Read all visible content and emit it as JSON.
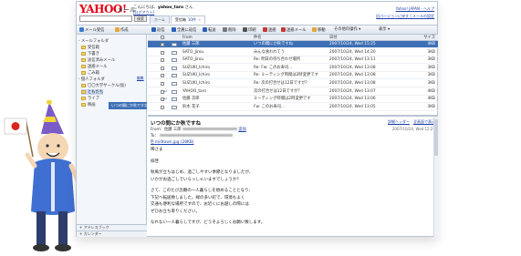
{
  "header": {
    "logo": "YAHOO!",
    "logo_sub": "JAPAN",
    "app_name": "メール",
    "greeting_prefix": "こんにちは、",
    "user": "yahoo_taro",
    "greeting_suffix": " さん",
    "logout": "[ログアウト]",
    "links": [
      "Yahoo! JAPAN - ヘルプ",
      "旧バージョンに戻す | メールの設定"
    ],
    "search_button": "検索"
  },
  "tabs": [
    {
      "label": "ホーム",
      "count": "",
      "active": false
    },
    {
      "label": "受信箱",
      "count": "10件",
      "active": true
    }
  ],
  "toolbar": [
    {
      "label": "メール受信",
      "icon": "mail-receive-icon",
      "color": "#3d7cc9"
    },
    {
      "label": "作成",
      "icon": "compose-icon",
      "color": "#e4a93a"
    },
    {
      "label": "返信",
      "icon": "reply-icon",
      "color": "#2a61b8"
    },
    {
      "label": "全員に返信",
      "icon": "reply-all-icon",
      "color": "#2a61b8"
    },
    {
      "label": "転送",
      "icon": "forward-icon",
      "color": "#2a61b8"
    },
    {
      "label": "削除",
      "icon": "delete-icon",
      "color": "#777777"
    },
    {
      "label": "印刷",
      "icon": "print-icon",
      "color": "#555555"
    },
    {
      "label": "迷惑",
      "icon": "spam-icon",
      "color": "#c23a3a"
    },
    {
      "label": "迷惑メール",
      "icon": "spam-mail-icon",
      "color": "#c23a3a"
    },
    {
      "label": "移動",
      "icon": "move-icon",
      "color": "#e4a93a"
    },
    {
      "label": "その他の操作 ▾",
      "icon": "",
      "color": ""
    },
    {
      "label": "表示 ▾",
      "icon": "",
      "color": ""
    }
  ],
  "sidebar": {
    "mail_folders_title": "- メールフォルダ",
    "mail_folders": [
      "受信箱",
      "下書き",
      "送信済みメール",
      "迷惑メール",
      "ごみ箱"
    ],
    "personal_title": "- 個人フォルダ",
    "edit_link": "編集",
    "personal_folders": [
      "〇〇大学サークル(仮)",
      "ともだち",
      "ライブ",
      "映画"
    ],
    "tooltip": "いつの間にか秋ですね",
    "bottom": [
      "+ アドレスブック",
      "+ カレンダー"
    ]
  },
  "message_list": {
    "columns": {
      "from": "From",
      "subject": "件名",
      "date": "日付",
      "size": "サイズ"
    },
    "rows": [
      {
        "from": "佐藤 三郎",
        "subject": "いつの間にか秋ですね",
        "date": "2007/10/24, Wed 15:25",
        "size": "4KB",
        "selected": true,
        "replied": false
      },
      {
        "from": "SATO_Jirou",
        "subject": "みんな食われてう",
        "date": "2007/10/24, Wed 14:20",
        "size": "3KB",
        "selected": false,
        "replied": false
      },
      {
        "from": "SATO_Jirou",
        "subject": "Re: 明日の待ち合わせ場所",
        "date": "2007/10/24, Wed 13:11",
        "size": "3KB",
        "selected": false,
        "replied": false
      },
      {
        "from": "SUZUKI_Ichiro",
        "subject": "Re: Fw: このお寿司...",
        "date": "2007/10/24, Wed 13:08",
        "size": "3KB",
        "selected": false,
        "replied": false
      },
      {
        "from": "SUZUKI_Ichiro",
        "subject": "Re: ミーティング時間は2時変更です",
        "date": "2007/10/24, Wed 13:08",
        "size": "3KB",
        "selected": false,
        "replied": false
      },
      {
        "from": "SUZUKI_Ichiro",
        "subject": "Re: 次の打合せは12日ですが？",
        "date": "2007/10/24, Wed 13:08",
        "size": "3KB",
        "selected": false,
        "replied": false
      },
      {
        "from": "YAHOO_taro",
        "subject": "次の打合せは12日ですが？",
        "date": "2007/10/24, Wed 13:07",
        "size": "4KB",
        "selected": false,
        "replied": true
      },
      {
        "from": "佐藤 次郎",
        "subject": "ミーティング時間は2時変更です",
        "date": "2007/10/24, Wed 13:06",
        "size": "4KB",
        "selected": false,
        "replied": true
      },
      {
        "from": "鈴木 花子",
        "subject": "Fw: このお寿司...",
        "date": "2007/10/24, Wed 13:05",
        "size": "3KB",
        "selected": false,
        "replied": false
      }
    ]
  },
  "preview": {
    "subject": "いつの間にか秋ですね",
    "links": [
      "詳細ヘッダー",
      "全画面で表示"
    ],
    "from_label": "From：",
    "from_name": "佐藤 三郎",
    "add_link": "追加",
    "date": "2007/10/24, Wed 15:25",
    "to_label": "To：",
    "attachment": "midtown.jpg (28KB)",
    "body": [
      "稀さま",
      "拝啓",
      "秋風が立ちはじめ、過ごしやすい季節となりましたが、\nいかがお過ごしでいらっしゃいますでしょうか？",
      "さて、このたび念願の一人暮らしを始めることとなり、\n下記へ転居致しました。緑の多い町で、環境もよく\n交通も便利な場所ですので、お近くにお越しの際には\nぜひお立ち寄りください。",
      "なれない一人暮らしですが、どうぞよろしくお願い致します。"
    ]
  },
  "colors": {
    "brand_red": "#e60012",
    "selection_blue": "#3d6fb5",
    "link_blue": "#1a3fa8",
    "border": "#b8c4d4"
  }
}
